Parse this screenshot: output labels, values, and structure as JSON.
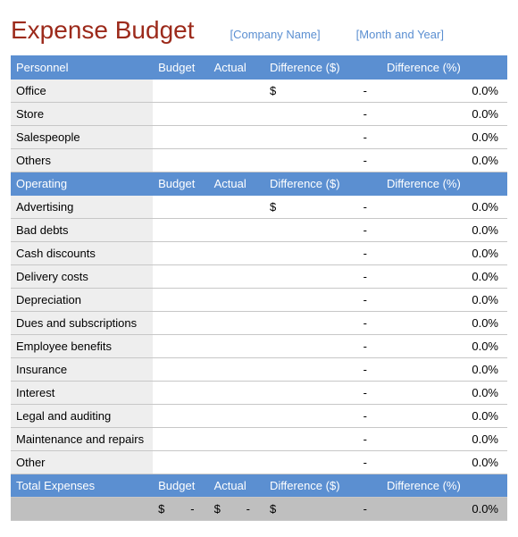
{
  "header": {
    "title": "Expense Budget",
    "company_placeholder": "[Company Name]",
    "date_placeholder": "[Month and Year]"
  },
  "columns": {
    "budget": "Budget",
    "actual": "Actual",
    "diff_dollar": "Difference ($)",
    "diff_pct": "Difference (%)"
  },
  "sections": [
    {
      "name": "Personnel",
      "rows": [
        {
          "label": "Office",
          "budget": "",
          "actual": "",
          "diff_prefix": "$",
          "diff": "-",
          "pct": "0.0%"
        },
        {
          "label": "Store",
          "budget": "",
          "actual": "",
          "diff_prefix": "",
          "diff": "-",
          "pct": "0.0%"
        },
        {
          "label": "Salespeople",
          "budget": "",
          "actual": "",
          "diff_prefix": "",
          "diff": "-",
          "pct": "0.0%"
        },
        {
          "label": "Others",
          "budget": "",
          "actual": "",
          "diff_prefix": "",
          "diff": "-",
          "pct": "0.0%"
        }
      ]
    },
    {
      "name": "Operating",
      "rows": [
        {
          "label": "Advertising",
          "budget": "",
          "actual": "",
          "diff_prefix": "$",
          "diff": "-",
          "pct": "0.0%"
        },
        {
          "label": "Bad debts",
          "budget": "",
          "actual": "",
          "diff_prefix": "",
          "diff": "-",
          "pct": "0.0%"
        },
        {
          "label": "Cash discounts",
          "budget": "",
          "actual": "",
          "diff_prefix": "",
          "diff": "-",
          "pct": "0.0%"
        },
        {
          "label": "Delivery costs",
          "budget": "",
          "actual": "",
          "diff_prefix": "",
          "diff": "-",
          "pct": "0.0%"
        },
        {
          "label": "Depreciation",
          "budget": "",
          "actual": "",
          "diff_prefix": "",
          "diff": "-",
          "pct": "0.0%"
        },
        {
          "label": "Dues and subscriptions",
          "budget": "",
          "actual": "",
          "diff_prefix": "",
          "diff": "-",
          "pct": "0.0%"
        },
        {
          "label": "Employee benefits",
          "budget": "",
          "actual": "",
          "diff_prefix": "",
          "diff": "-",
          "pct": "0.0%"
        },
        {
          "label": "Insurance",
          "budget": "",
          "actual": "",
          "diff_prefix": "",
          "diff": "-",
          "pct": "0.0%"
        },
        {
          "label": "Interest",
          "budget": "",
          "actual": "",
          "diff_prefix": "",
          "diff": "-",
          "pct": "0.0%"
        },
        {
          "label": "Legal and auditing",
          "budget": "",
          "actual": "",
          "diff_prefix": "",
          "diff": "-",
          "pct": "0.0%"
        },
        {
          "label": "Maintenance and repairs",
          "budget": "",
          "actual": "",
          "diff_prefix": "",
          "diff": "-",
          "pct": "0.0%"
        },
        {
          "label": "Other",
          "budget": "",
          "actual": "",
          "diff_prefix": "",
          "diff": "-",
          "pct": "0.0%"
        }
      ]
    }
  ],
  "total": {
    "name": "Total  Expenses",
    "budget_prefix": "$",
    "budget": "-",
    "actual_prefix": "$",
    "actual": "-",
    "diff_prefix": "$",
    "diff": "-",
    "pct": "0.0%"
  }
}
